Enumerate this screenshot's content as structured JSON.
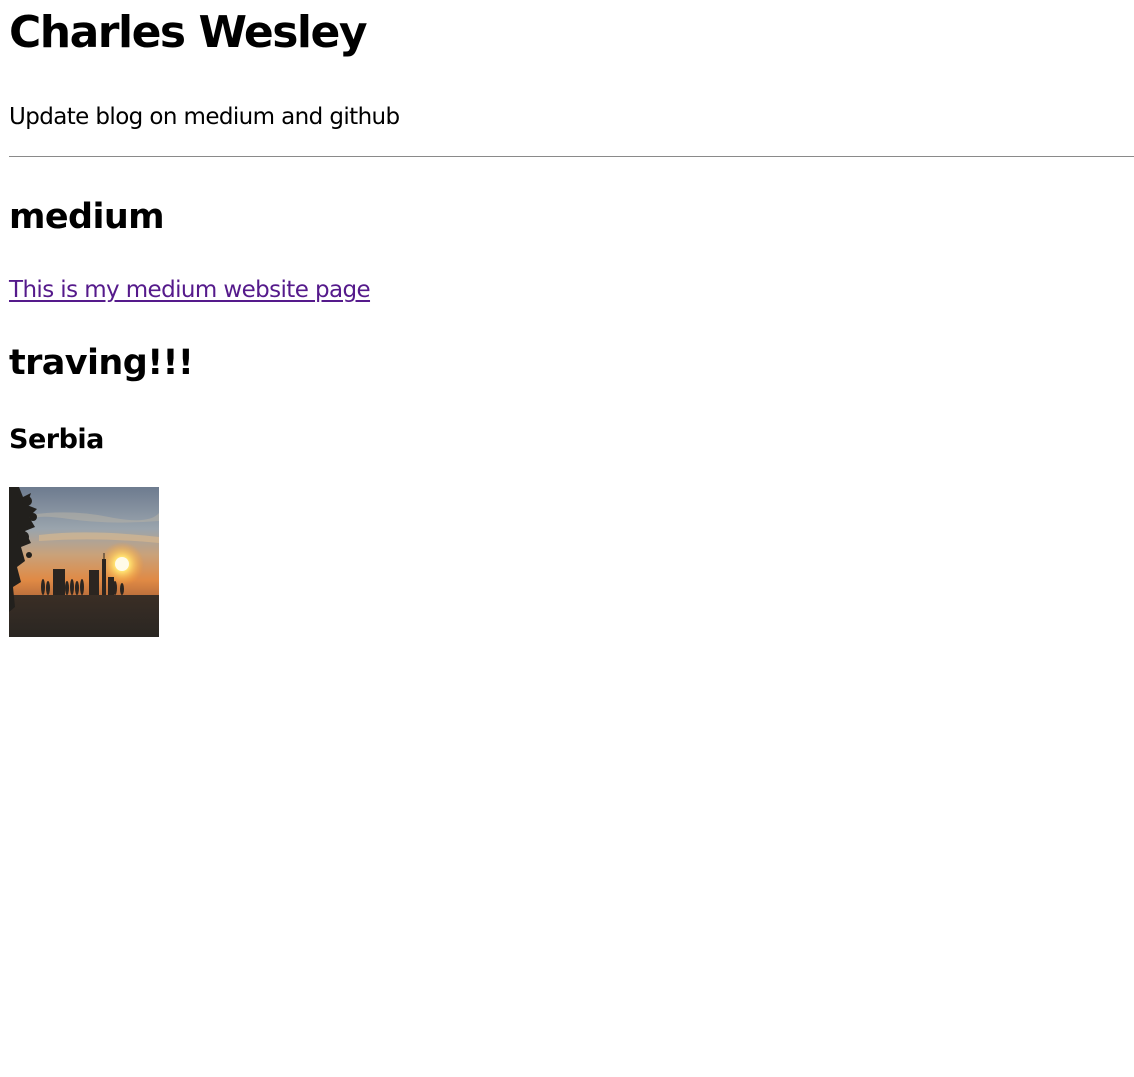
{
  "header": {
    "title": "Charles Wesley",
    "subtitle": "Update blog on medium and github"
  },
  "sections": {
    "medium": {
      "heading": "medium",
      "link_text": "This is my medium website page",
      "link_color": "#551a8b"
    },
    "travel": {
      "heading": "traving!!!",
      "place": "Serbia",
      "photo_icon": "sunset-photo"
    }
  }
}
